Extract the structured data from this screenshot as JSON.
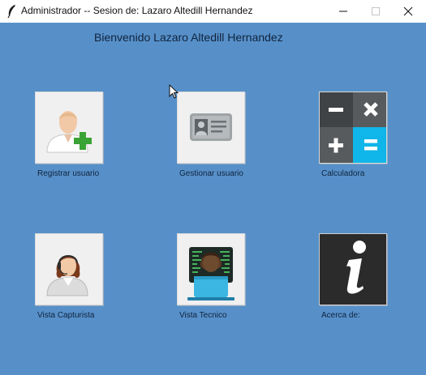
{
  "window": {
    "title": "Administrador -- Sesion de: Lazaro Altedill Hernandez",
    "icons": [
      "feather-icon",
      "minimize-icon",
      "maximize-icon",
      "close-icon"
    ]
  },
  "welcome": "Bienvenido Lazaro Altedill Hernandez",
  "tiles": [
    {
      "label": "Registrar usuario",
      "icon": "add-user-icon"
    },
    {
      "label": "Gestionar usuario",
      "icon": "id-card-icon"
    },
    {
      "label": "Calculadora",
      "icon": "calculator-icon"
    },
    {
      "label": "Vista Capturista",
      "icon": "operator-headset-icon"
    },
    {
      "label": "Vista Tecnico",
      "icon": "technician-laptop-icon"
    },
    {
      "label": "Acerca de:",
      "icon": "info-icon"
    }
  ],
  "colors": {
    "background": "#5790c9",
    "tile": "#f0f0f0",
    "calc_dark": "#4d5153",
    "calc_accent": "#10b5e9",
    "add_green": "#3aa335"
  }
}
